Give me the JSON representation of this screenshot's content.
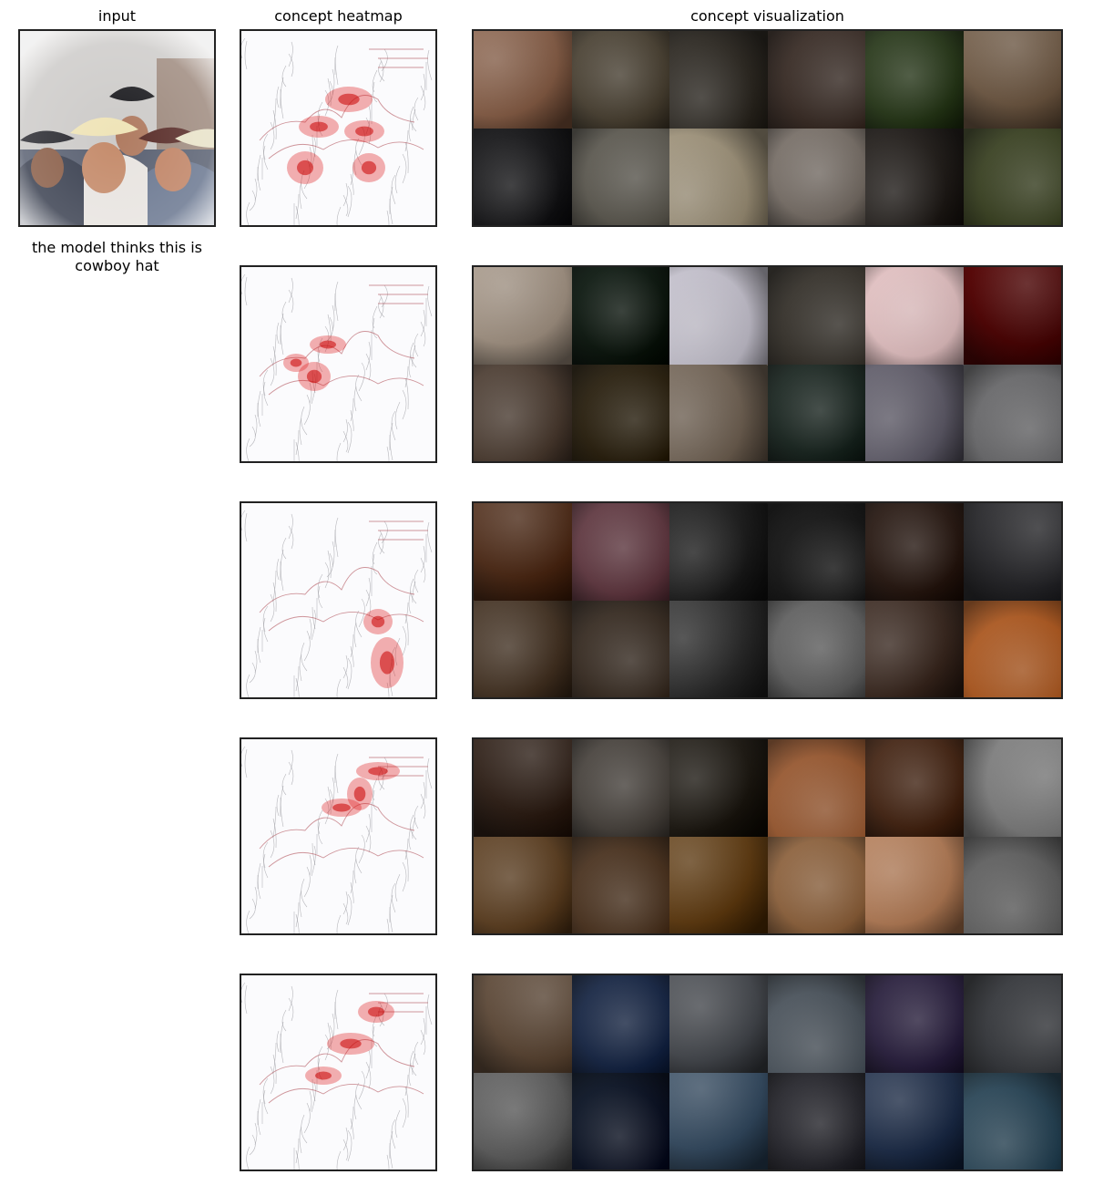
{
  "headers": {
    "input": "input",
    "heatmap": "concept heatmap",
    "visualization": "concept visualization"
  },
  "caption": "the model thinks this is\ncowboy hat",
  "rows": [
    {
      "tiles": [
        "#8f6a55",
        "#5b5346",
        "#3f3b35",
        "#4c403a",
        "#3b4a2e",
        "#7a6653",
        "#2a2a2c",
        "#6d6a62",
        "#a59a84",
        "#857d76",
        "#34302d",
        "#4e5538"
      ]
    },
    {
      "tiles": [
        "#a89a8c",
        "#1e2a22",
        "#c9c6d1",
        "#4a4640",
        "#e6c7c8",
        "#5a0b0b",
        "#5c4e44",
        "#3d3424",
        "#7c6f62",
        "#2f3a35",
        "#6d6a76",
        "#7a7a7c"
      ]
    },
    {
      "tiles": [
        "#5a3a28",
        "#6f4a52",
        "#2e2e2e",
        "#2a2a2a",
        "#3a2c26",
        "#3b3b3e",
        "#554537",
        "#4b4037",
        "#3c3c3c",
        "#707070",
        "#4a3a32",
        "#b86a36"
      ]
    },
    {
      "tiles": [
        "#3e3028",
        "#5a5550",
        "#2e2a24",
        "#a56a45",
        "#553828",
        "#8c8c8c",
        "#6b5035",
        "#5c4634",
        "#6b4a24",
        "#9a7250",
        "#b88664",
        "#707070"
      ]
    },
    {
      "tiles": [
        "#6b5848",
        "#2c3a56",
        "#54575c",
        "#5c646c",
        "#3d3450",
        "#4a4c50",
        "#6a6a6a",
        "#1c2636",
        "#44586c",
        "#3a3a40",
        "#2f3d56",
        "#3c5666"
      ]
    }
  ]
}
